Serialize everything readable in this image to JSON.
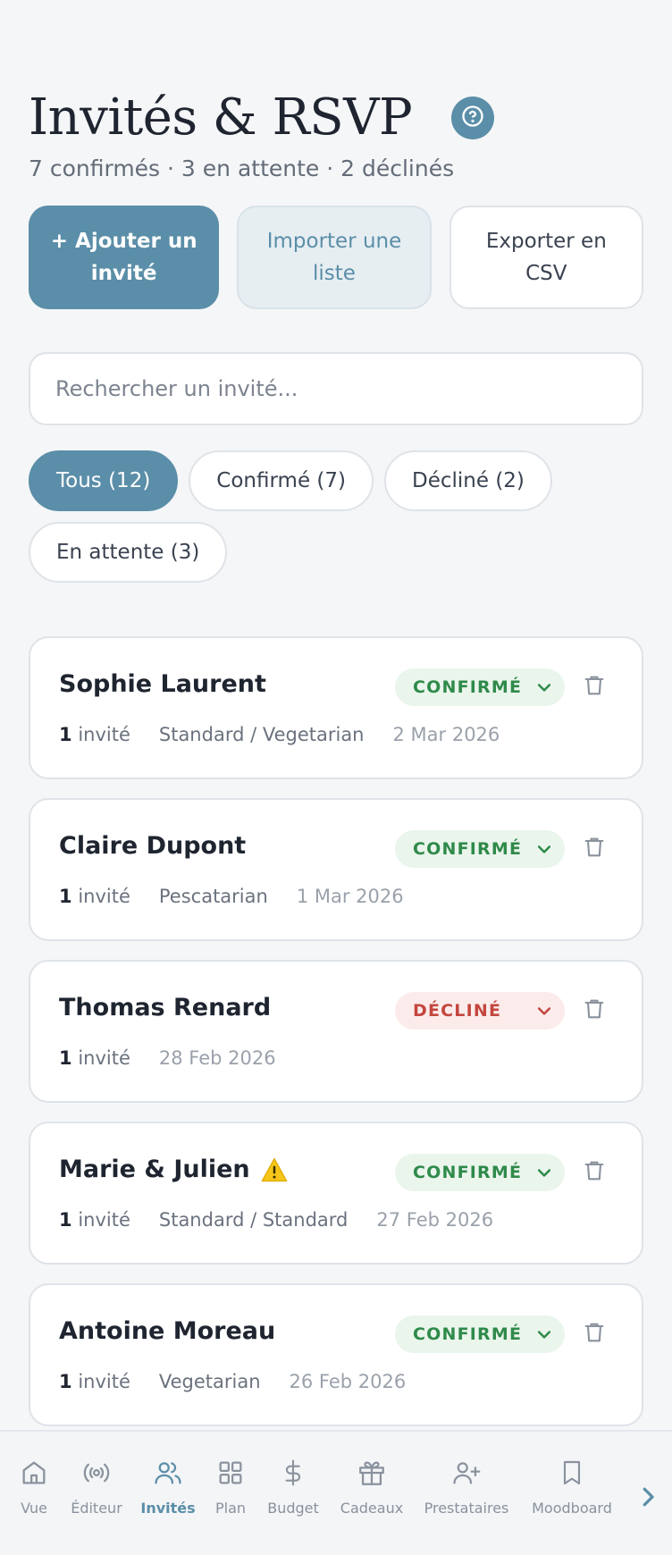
{
  "header": {
    "title": "Invités & RSVP",
    "subtitle": "7 confirmés · 3 en attente · 2 déclinés"
  },
  "actions": {
    "add_label": "+ Ajouter un invité",
    "import_label": "Importer une liste",
    "export_label": "Exporter en CSV"
  },
  "search": {
    "placeholder": "Rechercher un invité..."
  },
  "filters": [
    {
      "label": "Tous (12)",
      "active": true
    },
    {
      "label": "Confirmé (7)"
    },
    {
      "label": "Décliné (2)"
    },
    {
      "label": "En attente (3)"
    }
  ],
  "guests": [
    {
      "name": "Sophie Laurent",
      "status": "CONFIRMÉ",
      "count": "1",
      "count_unit": "invité",
      "meal": "Standard / Vegetarian",
      "date": "2 Mar 2026"
    },
    {
      "name": "Claire Dupont",
      "status": "CONFIRMÉ",
      "count": "1",
      "count_unit": "invité",
      "meal": "Pescatarian",
      "date": "1 Mar 2026"
    },
    {
      "name": "Thomas Renard",
      "status": "DÉCLINÉ",
      "count": "1",
      "count_unit": "invité",
      "meal": "",
      "date": "28 Feb 2026"
    },
    {
      "name": "Marie & Julien",
      "status": "CONFIRMÉ",
      "count": "1",
      "count_unit": "invité",
      "meal": "Standard / Standard",
      "date": "27 Feb 2026",
      "warning_icon": "warning-icon"
    },
    {
      "name": "Antoine Moreau",
      "status": "CONFIRMÉ",
      "count": "1",
      "count_unit": "invité",
      "meal": "Vegetarian",
      "date": "26 Feb 2026"
    }
  ],
  "nav": {
    "items": [
      {
        "label": "Vue",
        "icon": "home-icon"
      },
      {
        "label": "Éditeur",
        "icon": "broadcast-icon"
      },
      {
        "label": "Invités",
        "icon": "users-icon",
        "active": true
      },
      {
        "label": "Plan",
        "icon": "grid-icon"
      },
      {
        "label": "Budget",
        "icon": "dollar-icon"
      },
      {
        "label": "Cadeaux",
        "icon": "gift-icon"
      },
      {
        "label": "Prestataires",
        "icon": "user-plus-icon"
      },
      {
        "label": "Moodboard",
        "icon": "bookmark-icon"
      }
    ]
  },
  "colors": {
    "accent": "#5b8ea8",
    "confirmed": "#2f8a4a",
    "declined": "#c4463f",
    "warning": "#f5c518"
  }
}
